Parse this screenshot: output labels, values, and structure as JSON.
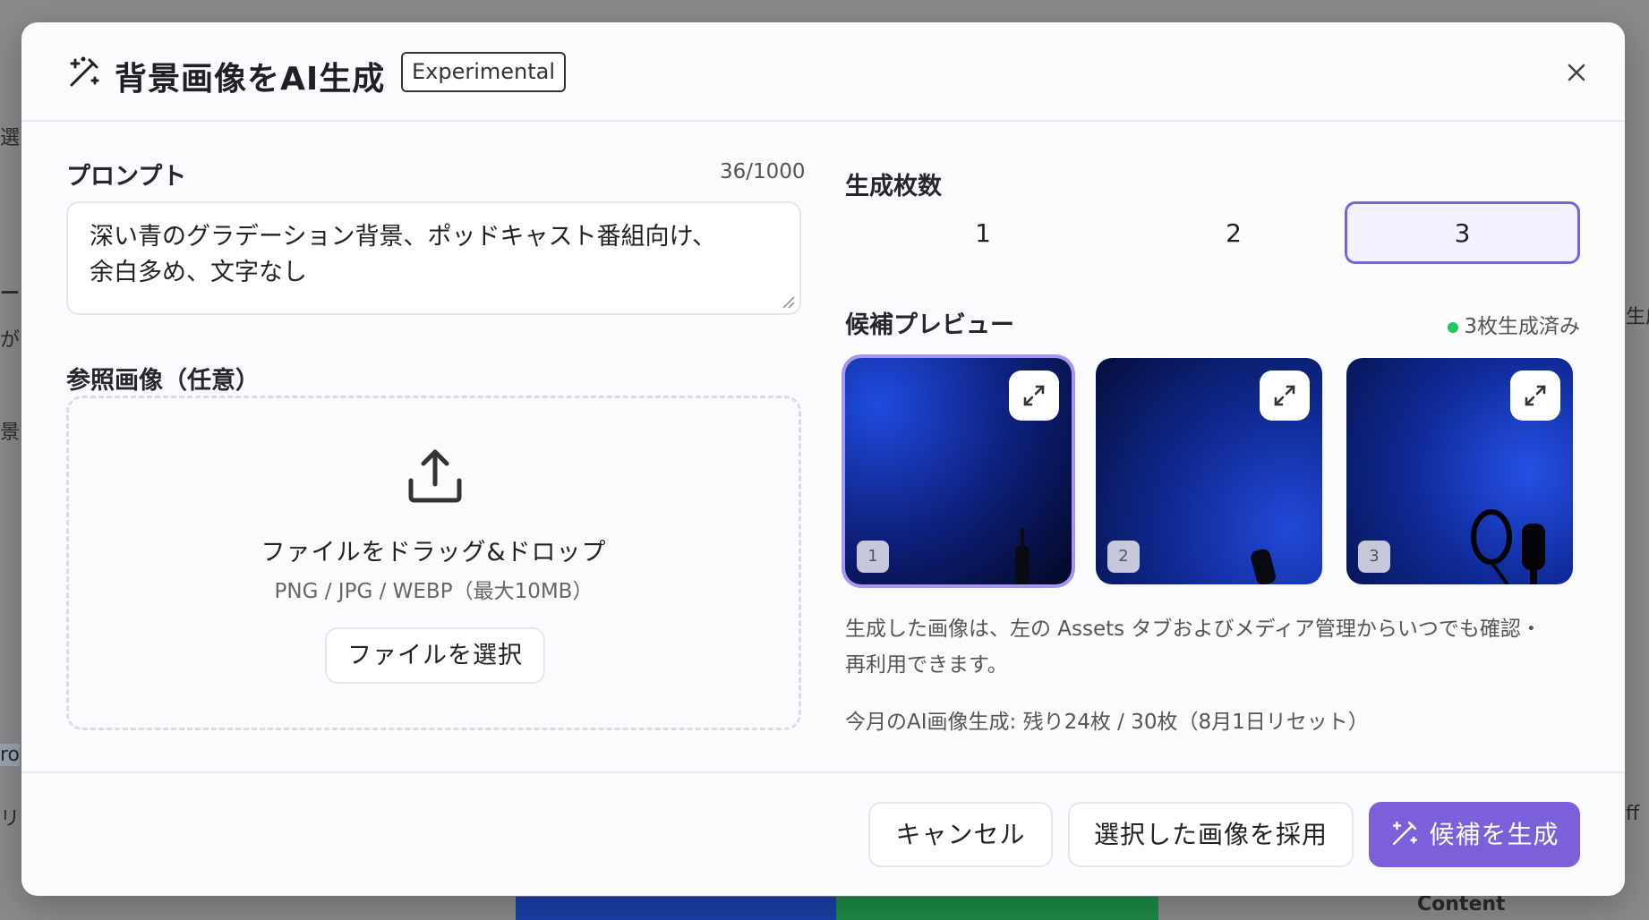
{
  "background": {
    "fragments": [
      "選択",
      "ー",
      "がら",
      "景",
      "ro",
      "リカ",
      "生成",
      "ff",
      "Content"
    ]
  },
  "modal": {
    "title": "背景画像をAI生成",
    "badge": "Experimental",
    "close_icon": "close-icon",
    "prompt": {
      "label": "プロンプト",
      "counter": "36/1000",
      "value_line1": "深い青のグラデーション背景、ポッドキャスト番組向け、",
      "value_line2": "余白多め、文字なし"
    },
    "reference": {
      "label": "参照画像（任意）",
      "drop_title": "ファイルをドラッグ&ドロップ",
      "drop_subtitle": "PNG / JPG / WEBP（最大10MB）",
      "select_button": "ファイルを選択"
    },
    "count": {
      "label": "生成枚数",
      "options": [
        "1",
        "2",
        "3"
      ],
      "selected": "3"
    },
    "preview": {
      "label": "候補プレビュー",
      "status": "3枚生成済み",
      "status_color": "#22c55e",
      "thumbnails": [
        {
          "number": "1",
          "selected": true
        },
        {
          "number": "2",
          "selected": false
        },
        {
          "number": "3",
          "selected": false
        }
      ]
    },
    "info_line1": "生成した画像は、左の Assets タブおよびメディア管理からいつでも確認・",
    "info_line2": "再利用できます。",
    "quota": "今月のAI画像生成: 残り24枚 / 30枚（8月1日リセット）",
    "footer": {
      "cancel": "キャンセル",
      "adopt": "選択した画像を採用",
      "generate": "候補を生成"
    },
    "accent_color": "#7b60d9"
  }
}
